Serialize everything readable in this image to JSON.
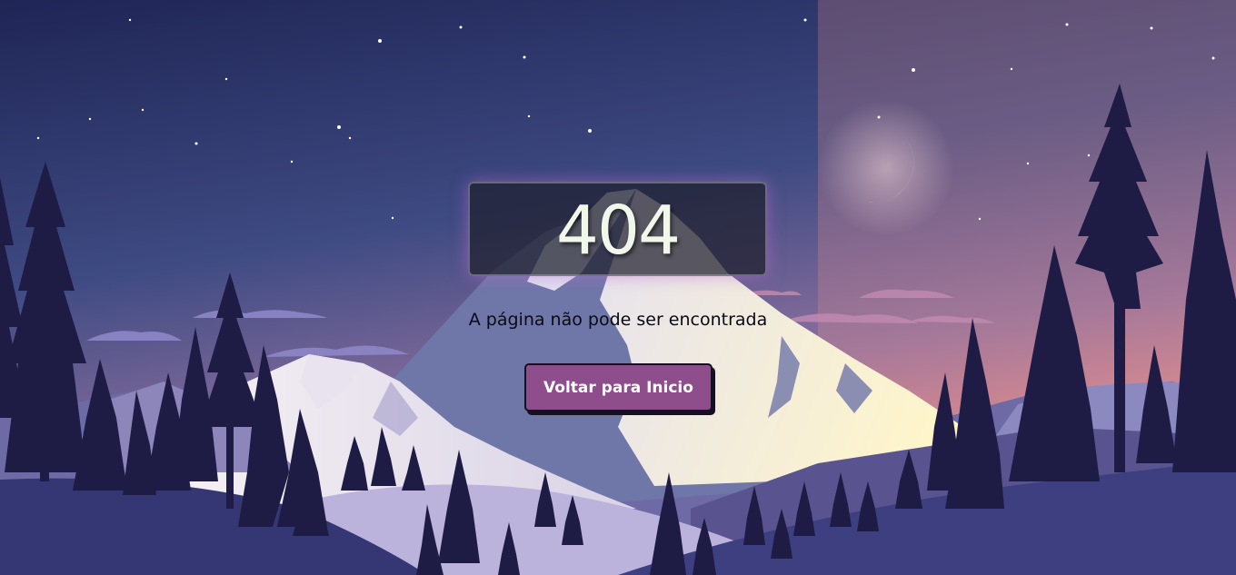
{
  "error": {
    "code": "404",
    "message": "A página não pode ser encontrada",
    "button_label": "Voltar para Inicio"
  },
  "colors": {
    "sky_top": "#1f2555",
    "sky_bottom": "#f0908c",
    "button": "#8e4e8c",
    "trees": "#1e1b45"
  }
}
